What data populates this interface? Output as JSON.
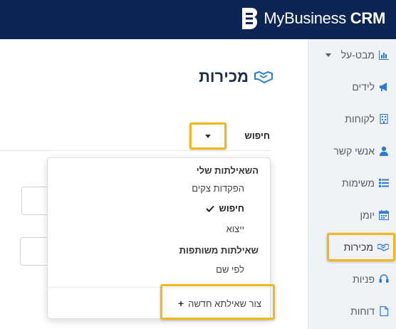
{
  "header": {
    "brand_name": "MyBusiness",
    "brand_suffix": "CRM",
    "logo_icon": "b-logo-icon"
  },
  "sidebar": {
    "items": [
      {
        "label": "מבט-על",
        "icon": "chart-icon",
        "has_caret": true
      },
      {
        "label": "לידים",
        "icon": "megaphone-icon"
      },
      {
        "label": "לקוחות",
        "icon": "building-icon"
      },
      {
        "label": "אנשי קשר",
        "icon": "user-icon"
      },
      {
        "label": "משימות",
        "icon": "list-icon"
      },
      {
        "label": "יומן",
        "icon": "calendar-icon"
      },
      {
        "label": "מכירות",
        "icon": "handshake-icon",
        "active": true
      },
      {
        "label": "פניות",
        "icon": "headset-icon"
      },
      {
        "label": "דוחות",
        "icon": "file-icon"
      }
    ]
  },
  "main": {
    "title": "מכירות",
    "title_icon": "handshake-icon",
    "search_label": "חיפוש"
  },
  "menu": {
    "my_queries_header": "השאילתות שלי",
    "my_queries": [
      "הפקדות צקים",
      "חיפוש",
      "ייצוא"
    ],
    "selected_query": "חיפוש",
    "shared_header": "שאילתות משותפות",
    "shared_queries": [
      "לפי שם"
    ],
    "create_new": "צור שאילתא חדשה"
  },
  "colors": {
    "topbar": "#0c2552",
    "accent": "#2b7bd3",
    "highlight": "#f2b718",
    "title": "#1c2d48",
    "sidebar_bg": "#f0f2f5"
  }
}
